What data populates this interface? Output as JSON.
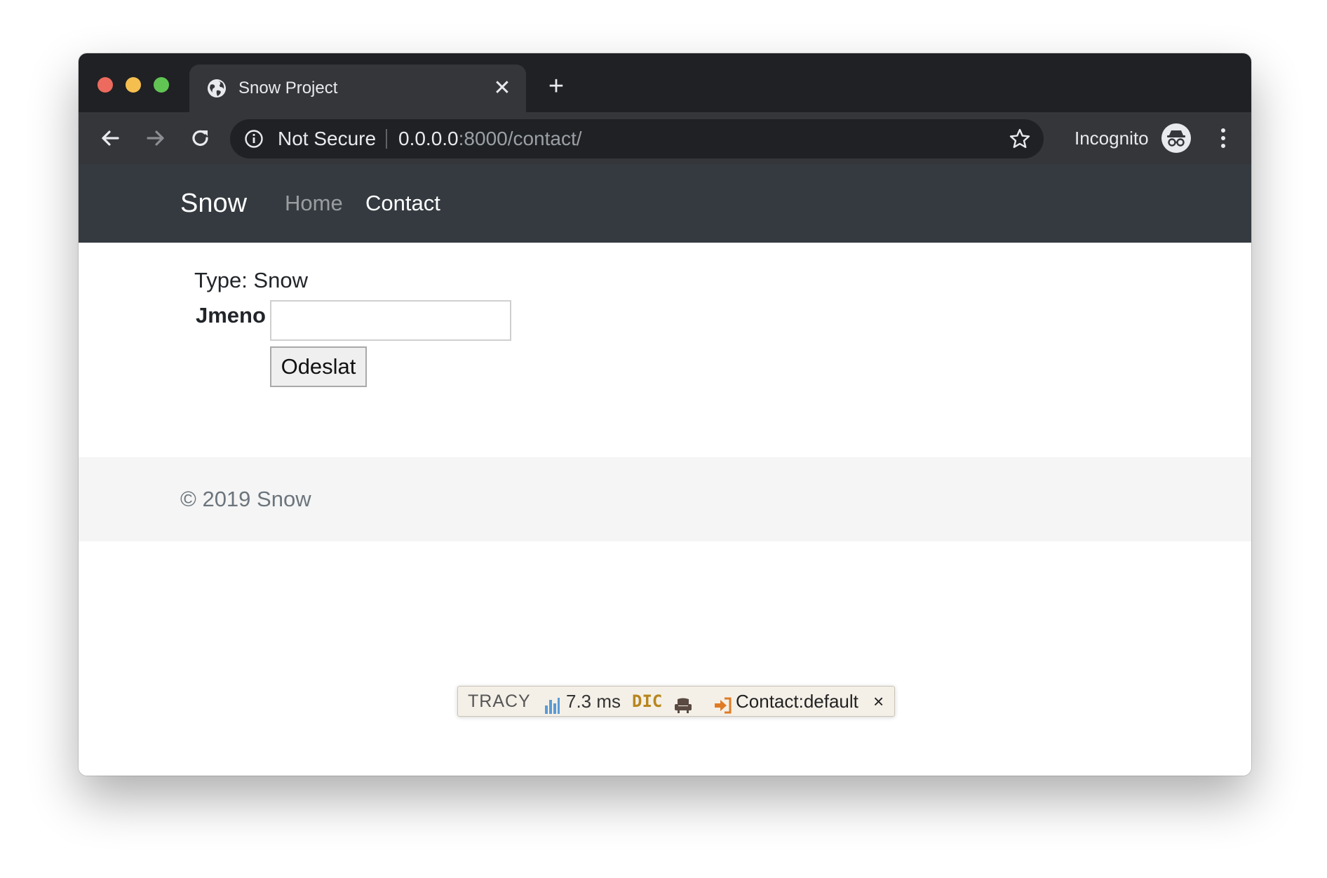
{
  "browser": {
    "tab_title": "Snow Project",
    "tab_close_glyph": "✕",
    "new_tab_glyph": "+",
    "security_label": "Not Secure",
    "url_host": "0.0.0.0",
    "url_rest": ":8000/contact/",
    "incognito_label": "Incognito",
    "icons": [
      "globe-icon",
      "close-icon",
      "plus-icon",
      "back-icon",
      "forward-icon",
      "reload-icon",
      "info-icon",
      "star-icon",
      "incognito-icon",
      "more-vert-icon"
    ]
  },
  "site": {
    "brand": "Snow",
    "nav": {
      "home": "Home",
      "contact": "Contact"
    },
    "active_nav": "contact"
  },
  "form": {
    "type_line": "Type: Snow",
    "name_label": "Jmeno",
    "name_value": "",
    "submit_label": "Odeslat"
  },
  "footer": {
    "copyright": "© 2019 Snow"
  },
  "tracy": {
    "logo": "TRACY",
    "time": "7.3 ms",
    "dic": "DIC",
    "presenter": "Contact:default",
    "close_glyph": "×"
  },
  "colors": {
    "tabstrip": "#202124",
    "toolbar": "#35363a",
    "navbar": "#343a40",
    "footer": "#f5f5f5"
  }
}
